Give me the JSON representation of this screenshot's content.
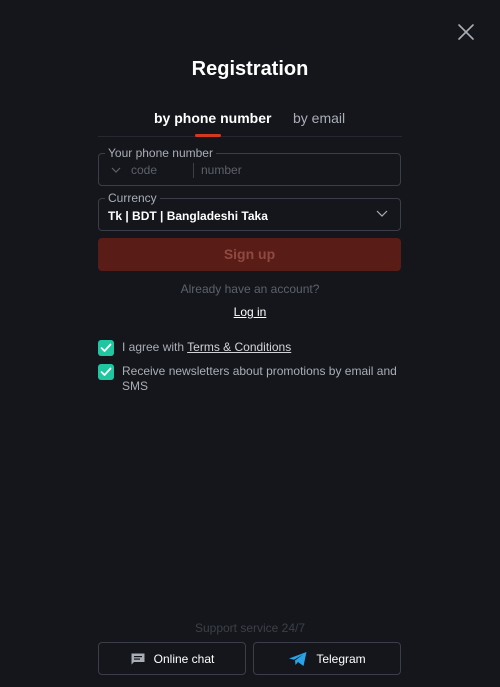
{
  "header": {
    "title": "Registration",
    "close_icon": "close-icon"
  },
  "tabs": [
    {
      "label": "by phone number",
      "active": true
    },
    {
      "label": "by email",
      "active": false
    }
  ],
  "phone": {
    "legend": "Your phone number",
    "code_placeholder": "code",
    "number_placeholder": "number"
  },
  "currency": {
    "legend": "Currency",
    "value": "Tk | BDT | Bangladeshi Taka"
  },
  "signup": {
    "label": "Sign up"
  },
  "login": {
    "prompt": "Already have an account?",
    "link": "Log in"
  },
  "consents": {
    "terms_prefix": "I agree with ",
    "terms_link": "Terms & Conditions",
    "terms_checked": true,
    "newsletter": "Receive newsletters about promotions by email and SMS",
    "newsletter_checked": true
  },
  "support": {
    "title": "Support service 24/7",
    "chat_label": "Online chat",
    "telegram_label": "Telegram"
  },
  "colors": {
    "accent": "#d2391e",
    "checkbox": "#1fc7a1",
    "background": "#14161b"
  }
}
